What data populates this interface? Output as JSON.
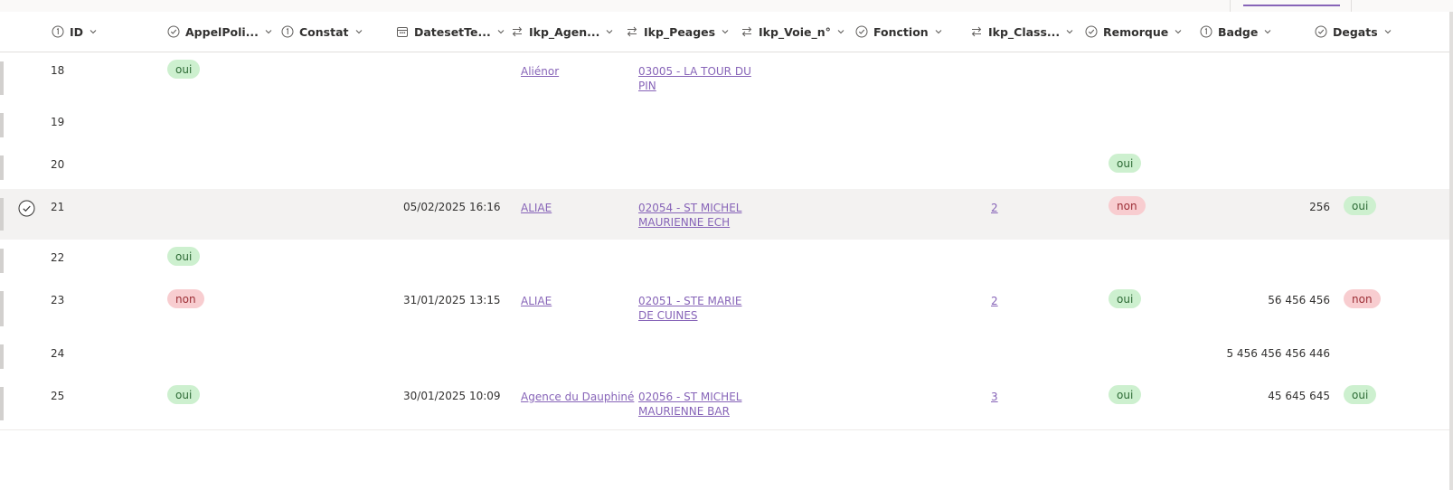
{
  "columns": [
    {
      "label": "ID",
      "icon": "number-icon"
    },
    {
      "label": "AppelPoli...",
      "icon": "check-circle-icon"
    },
    {
      "label": "Constat",
      "icon": "number-icon"
    },
    {
      "label": "DatesetTe...",
      "icon": "calendar-icon"
    },
    {
      "label": "Ikp_Agen...",
      "icon": "lookup-arrows-icon"
    },
    {
      "label": "Ikp_Peages",
      "icon": "lookup-arrows-icon"
    },
    {
      "label": "Ikp_Voie_n°",
      "icon": "lookup-arrows-icon"
    },
    {
      "label": "Fonction",
      "icon": "check-circle-icon"
    },
    {
      "label": "Ikp_Class...",
      "icon": "lookup-arrows-icon"
    },
    {
      "label": "Remorque",
      "icon": "check-circle-icon"
    },
    {
      "label": "Badge",
      "icon": "number-icon"
    },
    {
      "label": "Degats",
      "icon": "check-circle-icon"
    }
  ],
  "rows": [
    {
      "id": "18",
      "appel": "oui",
      "date": "",
      "agence": "Aliénor",
      "peage1": "03005 - LA TOUR DU",
      "peage2": "PIN",
      "classe": "",
      "remorque": "",
      "badge": "",
      "degats": ""
    },
    {
      "id": "19",
      "appel": "",
      "date": "",
      "agence": "",
      "peage1": "",
      "peage2": "",
      "classe": "",
      "remorque": "",
      "badge": "",
      "degats": ""
    },
    {
      "id": "20",
      "appel": "",
      "date": "",
      "agence": "",
      "peage1": "",
      "peage2": "",
      "classe": "",
      "remorque": "oui",
      "badge": "",
      "degats": ""
    },
    {
      "id": "21",
      "appel": "",
      "date": "05/02/2025 16:16",
      "agence": "ALIAE",
      "peage1": "02054 - ST MICHEL",
      "peage2": "MAURIENNE ECH",
      "classe": "2",
      "remorque": "non",
      "badge": "256",
      "degats": "oui"
    },
    {
      "id": "22",
      "appel": "oui",
      "date": "",
      "agence": "",
      "peage1": "",
      "peage2": "",
      "classe": "",
      "remorque": "",
      "badge": "",
      "degats": ""
    },
    {
      "id": "23",
      "appel": "non",
      "date": "31/01/2025 13:15",
      "agence": "ALIAE",
      "peage1": "02051 - STE MARIE",
      "peage2": "DE CUINES",
      "classe": "2",
      "remorque": "oui",
      "badge": "56 456 456",
      "degats": "non"
    },
    {
      "id": "24",
      "appel": "",
      "date": "",
      "agence": "",
      "peage1": "",
      "peage2": "",
      "classe": "",
      "remorque": "",
      "badge": "5 456 456 456 446",
      "degats": ""
    },
    {
      "id": "25",
      "appel": "oui",
      "date": "30/01/2025 10:09",
      "agence": "Agence du Dauphiné",
      "peage1": "02056 - ST MICHEL",
      "peage2": "MAURIENNE BAR",
      "classe": "3",
      "remorque": "oui",
      "badge": "45 645 645",
      "degats": "oui"
    }
  ],
  "colors": {
    "accent": "#8764b8",
    "pill_yes_bg": "#cdf0cf",
    "pill_no_bg": "#f8cdd0",
    "selected_row_bg": "#f3f2f1"
  }
}
